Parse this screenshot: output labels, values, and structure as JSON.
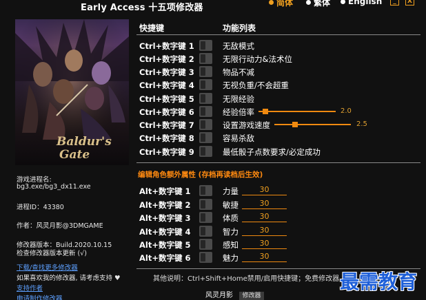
{
  "app": {
    "title": "Early Access 十五项修改器",
    "languages": [
      {
        "label": "简体",
        "active": true
      },
      {
        "label": "繁体",
        "active": false
      },
      {
        "label": "English",
        "active": false
      }
    ],
    "minimize_label": "_",
    "close_label": "X"
  },
  "cover": {
    "alt": "Baldur's Gate"
  },
  "info": {
    "process_label": "游戏进程名:",
    "process_value": "bg3.exe/bg3_dx11.exe",
    "pid_text": "进程ID：43380",
    "author_text": "作者：风灵月影@3DMGAME",
    "version_text": "修改器版本：Build.2020.10.15",
    "check_update": "检查修改器版本更新 (√)",
    "download_more": "下载/查找更多修改器",
    "support_text": "如果喜欢我的修改器, 请考虑支持 ♥",
    "support_link": "支持作者",
    "request_link": "申请制作修改器"
  },
  "headers": {
    "hotkey": "快捷键",
    "function": "功能列表"
  },
  "cheats": [
    {
      "hotkey": "Ctrl+数字键 1",
      "label": "无敌模式"
    },
    {
      "hotkey": "Ctrl+数字键 2",
      "label": "无限行动力&法术位"
    },
    {
      "hotkey": "Ctrl+数字键 3",
      "label": "物品不减"
    },
    {
      "hotkey": "Ctrl+数字键 4",
      "label": "无视负重/不会超重"
    },
    {
      "hotkey": "Ctrl+数字键 5",
      "label": "无限经验"
    },
    {
      "hotkey": "Ctrl+数字键 6",
      "label": "经验倍率",
      "slider_value": "2.0"
    },
    {
      "hotkey": "Ctrl+数字键 7",
      "label": "设置游戏速度",
      "slider_value": "2.5"
    },
    {
      "hotkey": "Ctrl+数字键 8",
      "label": "容易杀敌"
    },
    {
      "hotkey": "Ctrl+数字键 9",
      "label": "最低骰子点数要求/必定成功"
    }
  ],
  "attributes_title": "编辑角色额外属性 (存档再读档后生效)",
  "attributes": [
    {
      "hotkey": "Alt+数字键 1",
      "label": "力量",
      "value": "30"
    },
    {
      "hotkey": "Alt+数字键 2",
      "label": "敏捷",
      "value": "30"
    },
    {
      "hotkey": "Alt+数字键 3",
      "label": "体质",
      "value": "30"
    },
    {
      "hotkey": "Alt+数字键 4",
      "label": "智力",
      "value": "30"
    },
    {
      "hotkey": "Alt+数字键 5",
      "label": "感知",
      "value": "30"
    },
    {
      "hotkey": "Alt+数字键 6",
      "label": "魅力",
      "value": "30"
    }
  ],
  "footer": {
    "note": "其他说明：Ctrl+Shift+Home禁用/启用快捷键；免费修改器",
    "brand_logo": "风灵月影",
    "brand_button": "修改器"
  },
  "watermark": "最需教育",
  "colors": {
    "accent": "#f08a10",
    "link": "#5da0ff",
    "background": "#111111"
  }
}
